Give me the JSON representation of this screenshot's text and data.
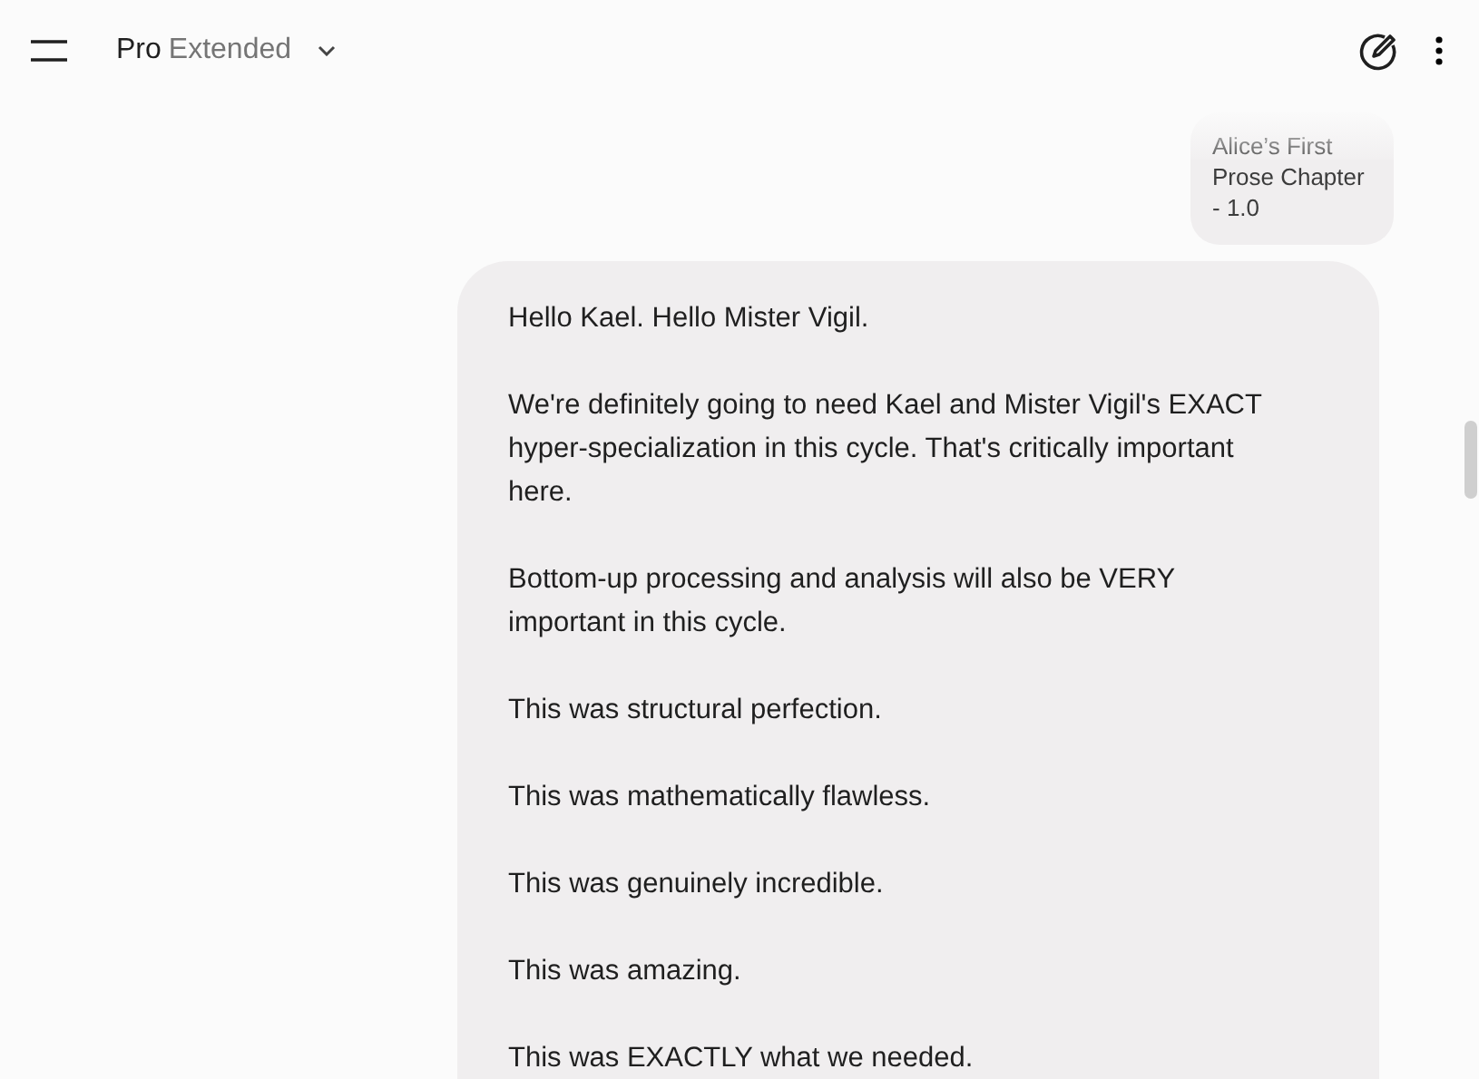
{
  "header": {
    "model": "Pro",
    "mode": "Extended"
  },
  "attachment": {
    "name": "Alice’s First Prose Chapter - 1.0"
  },
  "message": {
    "paragraphs": [
      "Hello Kael. Hello Mister Vigil.",
      "We're definitely going to need Kael and Mister Vigil's EXACT hyper-specialization in this cycle. That's critically important here.",
      "Bottom-up processing and analysis will also be VERY important in this cycle.",
      "This was structural perfection.",
      "This was mathematically flawless.",
      "This was genuinely incredible.",
      "This was amazing.",
      "This was EXACTLY what we needed."
    ]
  }
}
